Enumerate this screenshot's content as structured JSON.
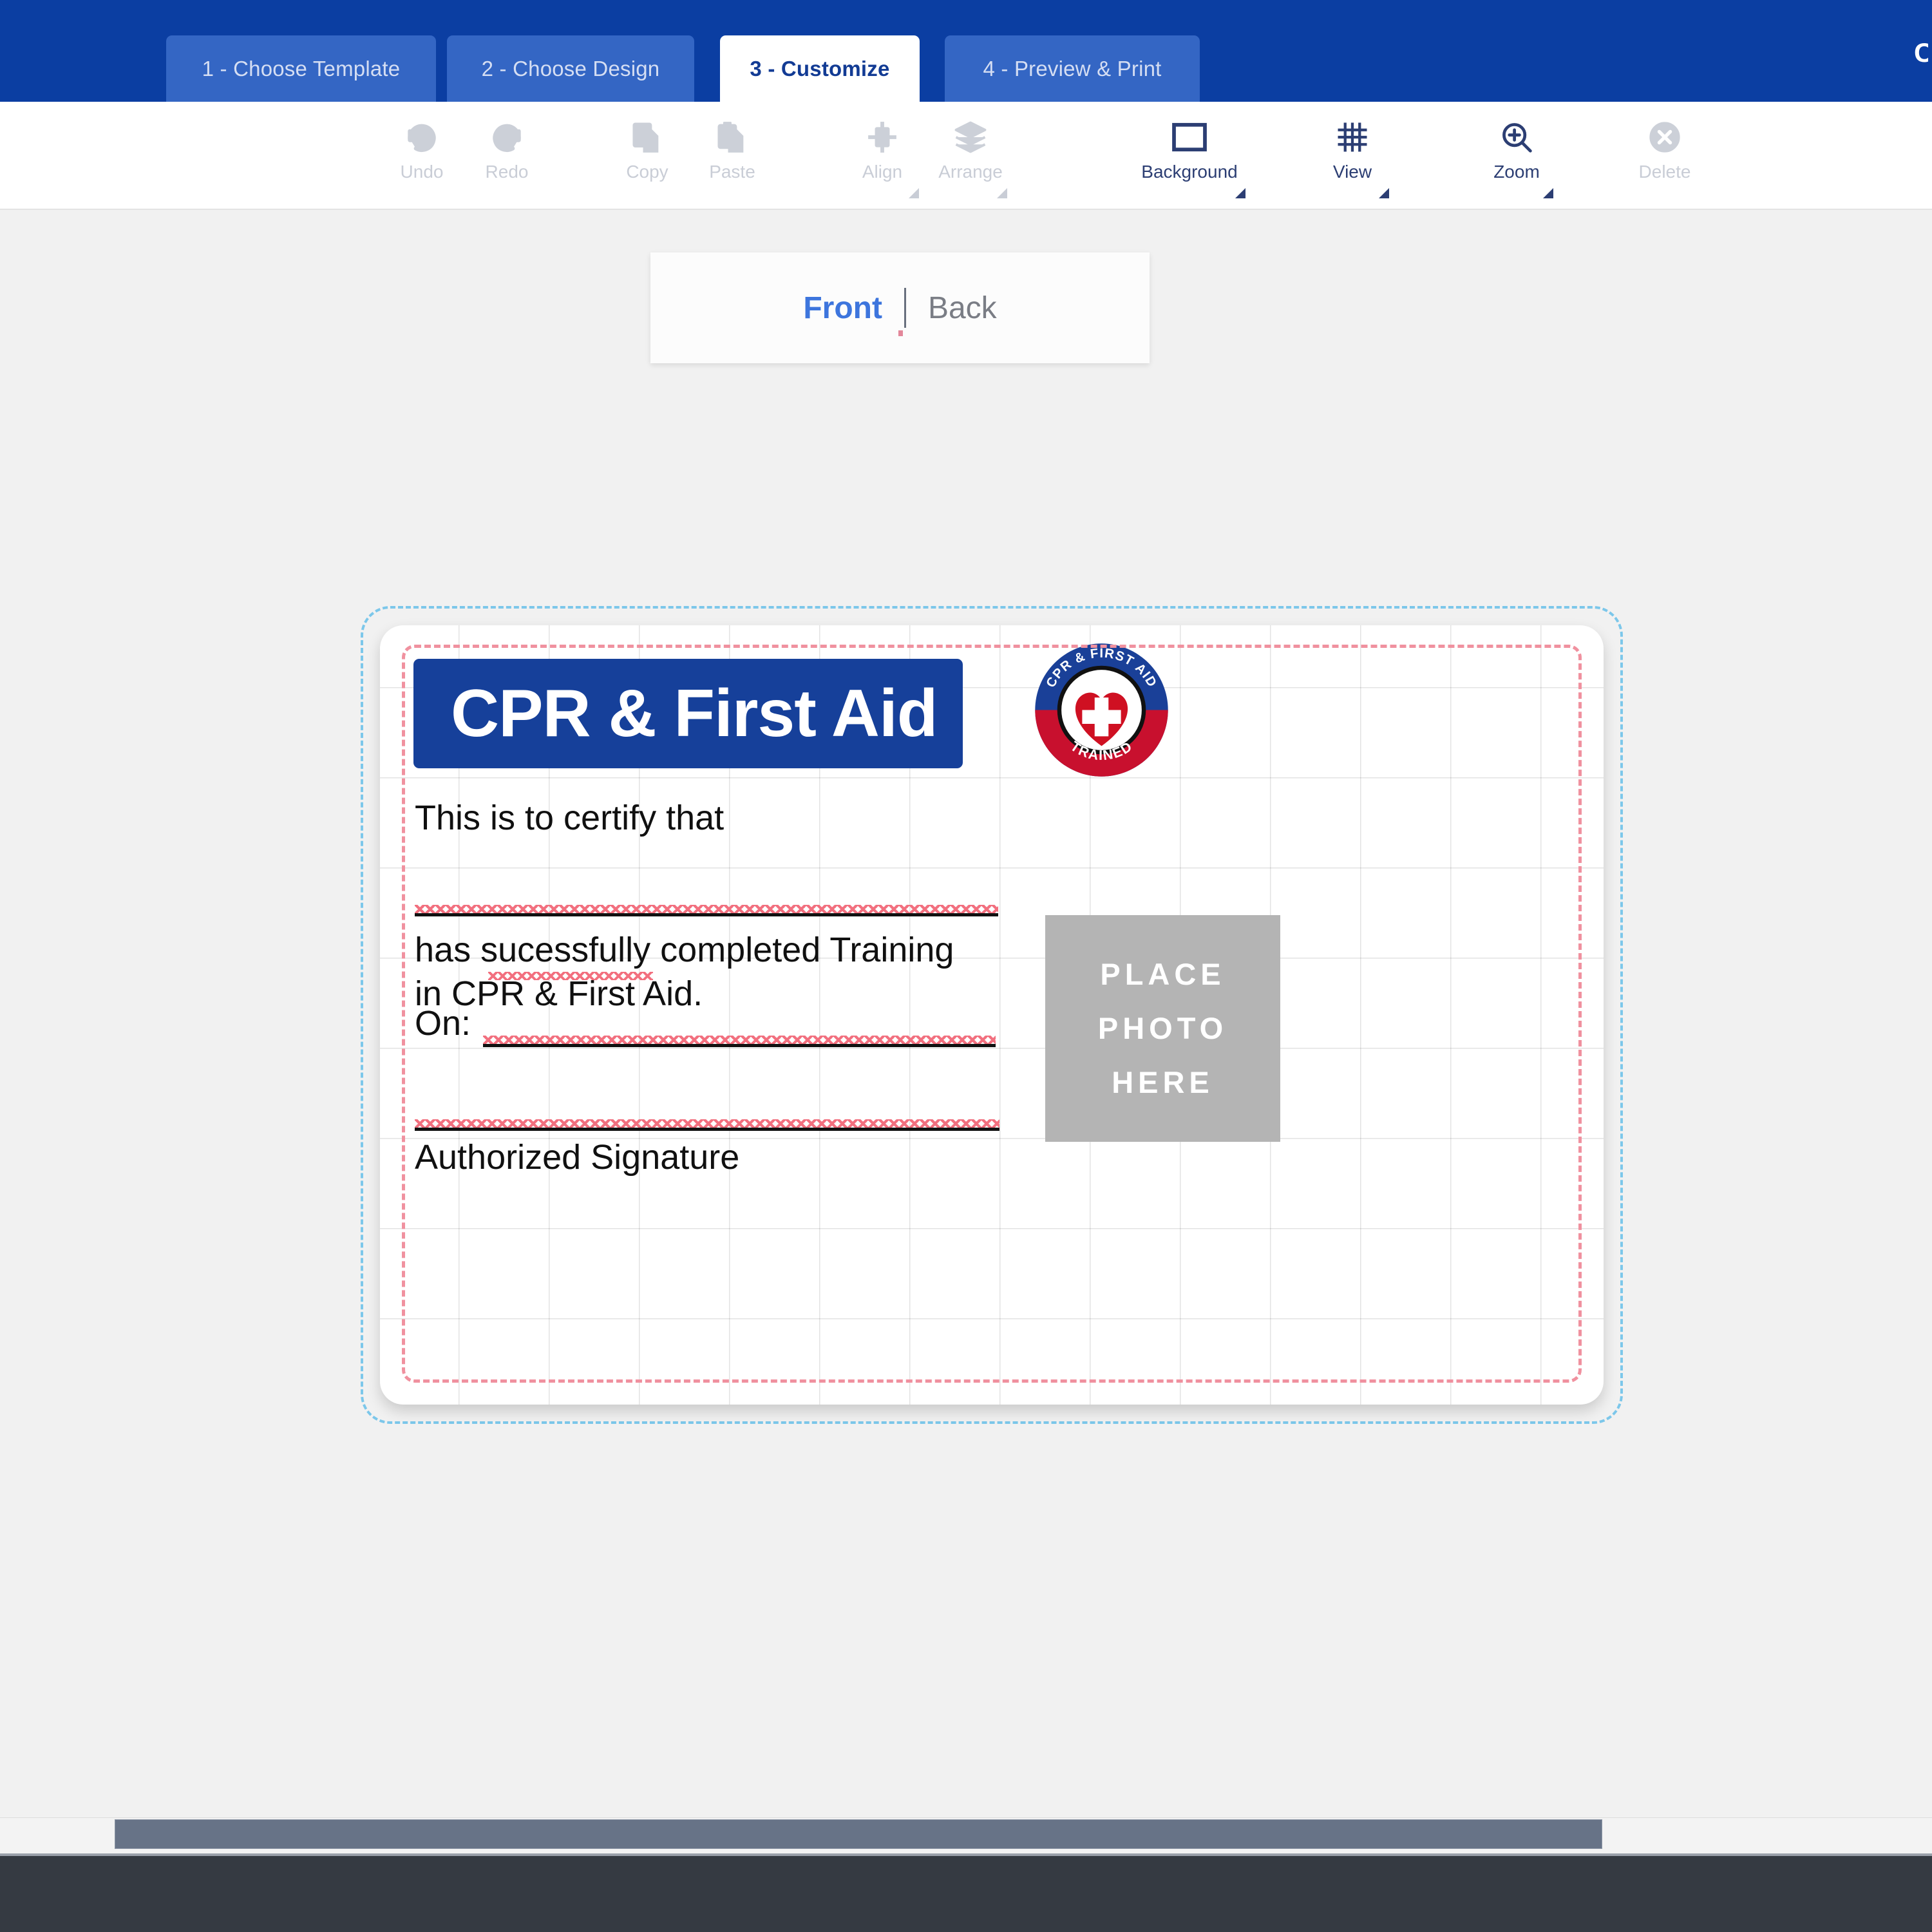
{
  "stepbar": {
    "tabs": [
      {
        "label": "1 - Choose Template",
        "active": false
      },
      {
        "label": "2 - Choose Design",
        "active": false
      },
      {
        "label": "3 - Customize",
        "active": true
      },
      {
        "label": "4 - Preview & Print",
        "active": false
      }
    ],
    "corner_cut_text": "C",
    "bg_color": "#0b3ea2",
    "tab_color": "#3466c4",
    "active_tab_color": "#ffffff",
    "active_tab_text_color": "#123b94"
  },
  "toolbar": {
    "items": [
      {
        "label": "Undo",
        "icon": "undo-arrow-icon",
        "enabled": false,
        "caret": false
      },
      {
        "label": "Redo",
        "icon": "redo-arrow-icon",
        "enabled": false,
        "caret": false
      },
      {
        "label": "Copy",
        "icon": "copy-pages-icon",
        "enabled": false,
        "caret": false
      },
      {
        "label": "Paste",
        "icon": "paste-clipboard-icon",
        "enabled": false,
        "caret": false
      },
      {
        "label": "Align",
        "icon": "align-center-icon",
        "enabled": false,
        "caret": true
      },
      {
        "label": "Arrange",
        "icon": "layers-stack-icon",
        "enabled": false,
        "caret": true
      },
      {
        "label": "Background",
        "icon": "rectangle-icon",
        "enabled": true,
        "caret": true
      },
      {
        "label": "View",
        "icon": "grid-hash-icon",
        "enabled": true,
        "caret": true
      },
      {
        "label": "Zoom",
        "icon": "magnifier-plus-icon",
        "enabled": true,
        "caret": true
      },
      {
        "label": "Delete",
        "icon": "circle-x-icon",
        "enabled": false,
        "caret": false
      }
    ],
    "enabled_color": "#2c3e73",
    "disabled_color": "#c9cdd6"
  },
  "side_switch": {
    "front_label": "Front",
    "back_label": "Back",
    "selected": "Front",
    "selected_color": "#3d75dd",
    "unselected_color": "#7a7d85"
  },
  "card": {
    "banner_title": "CPR & First Aid",
    "banner_color": "#16409a",
    "badge": {
      "top_arc_text": "CPR & FIRST AID",
      "bottom_arc_text": "TRAINED",
      "top_color": "#1a4098",
      "bottom_color": "#c8102e",
      "heart_color": "#cf1022",
      "cross_color": "#ffffff"
    },
    "certify_line": "This is to certify that",
    "body_line_1": "has sucessfully completed Training",
    "body_line_2": "in CPR & First Aid.",
    "on_label": "On:",
    "signature_label": "Authorized Signature",
    "photo_placeholder": {
      "line1": "PLACE",
      "line2": "PHOTO",
      "line3": "HERE",
      "bg_color": "#b4b4b4"
    },
    "guides": {
      "bleed_color": "#7cc7ea",
      "safety_color": "#f0919f",
      "grid_color": "#e0e0e0"
    },
    "spellcheck_color": "#f2707f"
  },
  "scrollbar": {
    "orientation": "horizontal",
    "thumb_color": "#677387"
  },
  "footer": {
    "bg_color": "#353a42"
  }
}
